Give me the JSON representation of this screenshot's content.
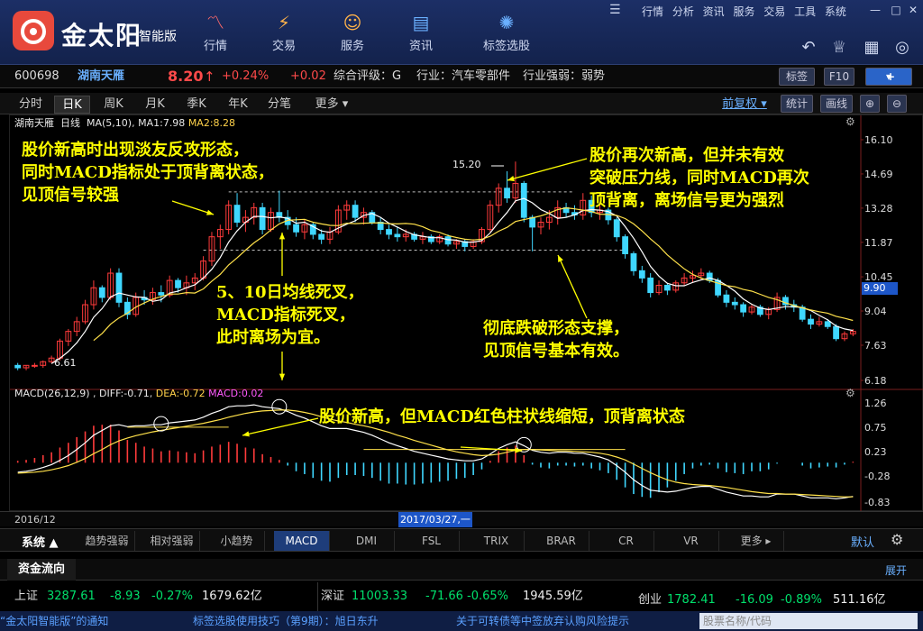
{
  "app": {
    "logo_text": "金太阳",
    "logo_sub": "智能版"
  },
  "nav": [
    {
      "label": "行情",
      "icon": "chart-line-icon"
    },
    {
      "label": "交易",
      "icon": "trade-icon"
    },
    {
      "label": "服务",
      "icon": "user-icon"
    },
    {
      "label": "资讯",
      "icon": "news-icon"
    },
    {
      "label": "标签选股",
      "icon": "bulb-icon"
    }
  ],
  "topmenu": "行情 分析 资讯 服务 交易 工具 系统",
  "stock": {
    "code": "600698",
    "name": "湖南天雁",
    "price": "8.20",
    "arrow": "↑",
    "pct": "+0.24%",
    "chg": "+0.02",
    "rating": "综合评级：G",
    "industry": "行业：汽车零部件",
    "strength": "行业强弱：弱势"
  },
  "buttons": {
    "tag": "标签",
    "f10": "F10",
    "plus": "+"
  },
  "period_tabs": [
    "分时",
    "日K",
    "周K",
    "月K",
    "季K",
    "年K",
    "分笔",
    "更多 ▾"
  ],
  "right_tools": {
    "fq": "前复权 ▾",
    "stat": "统计",
    "draw": "画线"
  },
  "main_legend": {
    "name": "湖南天雁",
    "period": "日线",
    "ma": "MA(5,10)",
    "ma1": "MA1:7.98",
    "ma2": "MA2:8.28"
  },
  "macd_legend": {
    "name": "MACD(26,12,9)",
    "diff": "DIFF:-0.71",
    "dea": "DEA:-0.72",
    "macd": "MACD:0.02"
  },
  "annotations": {
    "a1": "股价新高时出现淡友反攻形态，\n同时MACD指标处于顶背离状态，\n见顶信号较强",
    "a2": "股价再次新高，但并未有效\n突破压力线，同时MACD再次\n顶背离，离场信号更为强烈",
    "a3": "5、10日均线死叉，\nMACD指标死叉，\n此时离场为宜。",
    "a4": "彻底跌破形态支撑，\n见顶信号基本有效。",
    "a5": "股价新高，但MACD红色柱状线缩短，顶背离状态"
  },
  "price_labels": {
    "high": "15.20",
    "low": "6.61",
    "current": "9.90"
  },
  "dates": {
    "start": "2016/12",
    "cursor": "2017/03/27,一"
  },
  "indicator_tabs": [
    "趋势强弱",
    "相对强弱",
    "小趋势",
    "MACD",
    "DMI",
    "FSL",
    "TRIX",
    "BRAR",
    "CR",
    "VR",
    "更多 ▸"
  ],
  "indicator_active": "MACD",
  "system_label": "系统 ▲",
  "default_label": "默认",
  "flow": {
    "label": "资金流向",
    "expand": "展开"
  },
  "market": {
    "sh": {
      "name": "上证",
      "value": "3287.61",
      "chg": "-8.93",
      "pct": "-0.27%",
      "amt": "1679.62亿"
    },
    "sz": {
      "name": "深证",
      "value": "11003.33",
      "chg": "-71.66",
      "pct": "-0.65%",
      "amt": "1945.59亿"
    },
    "cy": {
      "name": "创业",
      "value": "1782.41",
      "chg": "-16.09",
      "pct": "-0.89%",
      "amt": "511.16亿"
    }
  },
  "status": {
    "s1": "“金太阳智能版”的通知",
    "s2": "标签选股使用技巧（第9期）：旭日东升",
    "s3": "关于可转债等中签放弃认购风险提示",
    "search": "股票名称/代码"
  },
  "chart_data": {
    "type": "candlestick",
    "yaxis_main": [
      16.1,
      14.69,
      13.28,
      11.87,
      10.45,
      9.04,
      7.63,
      6.18
    ],
    "yaxis_macd": [
      1.26,
      0.75,
      0.23,
      -0.28,
      -0.83
    ],
    "ylim_main": [
      6.18,
      16.1
    ],
    "ylim_macd": [
      -0.83,
      1.26
    ],
    "candles": [
      [
        6.8,
        6.9,
        6.6,
        6.7
      ],
      [
        6.7,
        6.8,
        6.6,
        6.8
      ],
      [
        6.8,
        6.9,
        6.7,
        6.8
      ],
      [
        6.8,
        7.0,
        6.7,
        6.95
      ],
      [
        6.95,
        7.2,
        6.9,
        7.1
      ],
      [
        7.1,
        7.9,
        7.0,
        7.8
      ],
      [
        7.8,
        8.3,
        7.6,
        8.2
      ],
      [
        8.2,
        8.8,
        8.0,
        8.6
      ],
      [
        8.6,
        9.5,
        8.5,
        9.3
      ],
      [
        9.3,
        10.3,
        9.1,
        10.0
      ],
      [
        10.0,
        10.1,
        9.4,
        9.6
      ],
      [
        9.6,
        10.8,
        9.5,
        10.6
      ],
      [
        10.6,
        10.8,
        9.2,
        9.4
      ],
      [
        9.4,
        9.6,
        8.7,
        8.9
      ],
      [
        8.9,
        9.8,
        8.8,
        9.6
      ],
      [
        9.6,
        9.9,
        9.3,
        9.5
      ],
      [
        9.5,
        10.0,
        9.3,
        9.8
      ],
      [
        9.8,
        10.1,
        9.4,
        9.7
      ],
      [
        9.7,
        10.5,
        9.6,
        10.3
      ],
      [
        10.3,
        10.4,
        9.8,
        10.0
      ],
      [
        10.0,
        10.5,
        9.7,
        10.2
      ],
      [
        10.2,
        10.6,
        9.9,
        10.4
      ],
      [
        10.4,
        11.3,
        10.3,
        11.1
      ],
      [
        11.1,
        12.3,
        10.9,
        12.1
      ],
      [
        12.1,
        12.6,
        11.6,
        12.4
      ],
      [
        12.4,
        13.6,
        12.2,
        13.4
      ],
      [
        13.4,
        13.9,
        12.5,
        12.7
      ],
      [
        12.7,
        13.2,
        12.3,
        12.9
      ],
      [
        12.9,
        13.5,
        12.6,
        13.3
      ],
      [
        13.3,
        13.5,
        12.2,
        12.4
      ],
      [
        12.4,
        13.3,
        12.3,
        13.1
      ],
      [
        13.1,
        14.0,
        12.7,
        12.9
      ],
      [
        12.9,
        13.2,
        12.4,
        12.6
      ],
      [
        12.6,
        12.9,
        12.1,
        12.3
      ],
      [
        12.3,
        12.8,
        12.0,
        12.6
      ],
      [
        12.6,
        12.7,
        12.0,
        12.2
      ],
      [
        12.2,
        12.4,
        11.8,
        12.0
      ],
      [
        12.0,
        12.5,
        11.8,
        12.3
      ],
      [
        12.3,
        13.4,
        12.2,
        13.2
      ],
      [
        13.2,
        13.6,
        12.8,
        13.4
      ],
      [
        13.4,
        13.6,
        12.7,
        12.9
      ],
      [
        12.9,
        13.3,
        12.6,
        13.1
      ],
      [
        13.1,
        13.2,
        12.6,
        12.7
      ],
      [
        12.7,
        12.9,
        12.2,
        12.4
      ],
      [
        12.4,
        12.6,
        12.0,
        12.2
      ],
      [
        12.2,
        12.5,
        11.9,
        12.1
      ],
      [
        12.1,
        12.4,
        11.9,
        12.2
      ],
      [
        12.2,
        12.3,
        11.9,
        12.0
      ],
      [
        12.0,
        12.3,
        11.8,
        12.1
      ],
      [
        12.1,
        12.2,
        11.8,
        11.9
      ],
      [
        11.9,
        12.2,
        11.8,
        12.1
      ],
      [
        12.1,
        12.2,
        11.7,
        11.8
      ],
      [
        11.8,
        12.0,
        11.6,
        11.9
      ],
      [
        11.9,
        12.0,
        11.5,
        11.7
      ],
      [
        11.7,
        12.0,
        11.6,
        11.9
      ],
      [
        11.9,
        12.5,
        11.8,
        12.4
      ],
      [
        12.4,
        13.6,
        12.3,
        13.4
      ],
      [
        13.4,
        14.3,
        13.1,
        14.1
      ],
      [
        14.1,
        14.8,
        13.5,
        13.7
      ],
      [
        13.7,
        15.2,
        13.5,
        14.3
      ],
      [
        14.3,
        14.4,
        12.7,
        12.9
      ],
      [
        12.9,
        13.0,
        11.5,
        12.5
      ],
      [
        12.5,
        12.9,
        12.2,
        12.7
      ],
      [
        12.7,
        13.2,
        12.4,
        12.9
      ],
      [
        12.9,
        13.6,
        12.6,
        13.3
      ],
      [
        13.3,
        13.5,
        12.9,
        13.1
      ],
      [
        13.1,
        13.4,
        12.8,
        13.0
      ],
      [
        13.0,
        13.9,
        12.8,
        13.6
      ],
      [
        13.6,
        13.8,
        12.9,
        13.1
      ],
      [
        13.1,
        13.4,
        12.8,
        13.2
      ],
      [
        13.2,
        13.3,
        12.6,
        12.8
      ],
      [
        12.8,
        12.9,
        11.9,
        12.1
      ],
      [
        12.1,
        12.2,
        11.2,
        11.4
      ],
      [
        11.4,
        11.5,
        10.5,
        10.7
      ],
      [
        10.7,
        10.9,
        10.2,
        10.4
      ],
      [
        10.4,
        10.6,
        9.6,
        9.8
      ],
      [
        9.8,
        10.3,
        9.7,
        10.1
      ],
      [
        10.1,
        10.2,
        9.7,
        9.9
      ],
      [
        9.9,
        10.3,
        9.8,
        10.2
      ],
      [
        10.2,
        10.6,
        10.1,
        10.4
      ],
      [
        10.4,
        10.7,
        10.2,
        10.5
      ],
      [
        10.5,
        10.8,
        10.3,
        10.6
      ],
      [
        10.6,
        10.7,
        10.2,
        10.3
      ],
      [
        10.3,
        10.4,
        9.6,
        9.7
      ],
      [
        9.7,
        9.9,
        9.2,
        9.4
      ],
      [
        9.4,
        9.6,
        9.1,
        9.3
      ],
      [
        9.3,
        9.4,
        8.8,
        9.0
      ],
      [
        9.0,
        9.3,
        8.9,
        9.2
      ],
      [
        9.2,
        9.3,
        8.8,
        8.9
      ],
      [
        8.9,
        9.2,
        8.7,
        9.1
      ],
      [
        9.1,
        9.8,
        9.0,
        9.6
      ],
      [
        9.6,
        9.7,
        9.1,
        9.3
      ],
      [
        9.3,
        9.5,
        9.0,
        9.2
      ],
      [
        9.2,
        9.3,
        8.6,
        8.7
      ],
      [
        8.7,
        8.9,
        8.3,
        8.5
      ],
      [
        8.5,
        8.8,
        8.4,
        8.6
      ],
      [
        8.6,
        8.7,
        8.3,
        8.4
      ],
      [
        8.4,
        8.5,
        7.8,
        7.9
      ],
      [
        7.9,
        8.2,
        7.8,
        8.1
      ],
      [
        8.1,
        8.3,
        8.0,
        8.2
      ]
    ],
    "ma_window": [
      5,
      10
    ],
    "macd_diff": [
      -0.2,
      -0.18,
      -0.15,
      -0.1,
      -0.04,
      0.05,
      0.15,
      0.28,
      0.42,
      0.58,
      0.68,
      0.78,
      0.8,
      0.76,
      0.78,
      0.78,
      0.8,
      0.8,
      0.84,
      0.86,
      0.88,
      0.9,
      0.96,
      1.04,
      1.1,
      1.18,
      1.2,
      1.2,
      1.22,
      1.18,
      1.16,
      1.14,
      1.08,
      1.0,
      0.94,
      0.86,
      0.78,
      0.72,
      0.72,
      0.72,
      0.68,
      0.64,
      0.58,
      0.5,
      0.42,
      0.36,
      0.3,
      0.24,
      0.2,
      0.16,
      0.12,
      0.08,
      0.06,
      0.04,
      0.04,
      0.08,
      0.18,
      0.3,
      0.38,
      0.44,
      0.36,
      0.26,
      0.22,
      0.2,
      0.22,
      0.22,
      0.2,
      0.2,
      0.16,
      0.12,
      0.06,
      -0.06,
      -0.2,
      -0.36,
      -0.48,
      -0.58,
      -0.6,
      -0.62,
      -0.6,
      -0.56,
      -0.52,
      -0.5,
      -0.5,
      -0.56,
      -0.62,
      -0.66,
      -0.7,
      -0.7,
      -0.72,
      -0.72,
      -0.66,
      -0.66,
      -0.66,
      -0.7,
      -0.74,
      -0.74,
      -0.74,
      -0.76,
      -0.74,
      -0.71
    ],
    "macd_dea": [
      -0.22,
      -0.21,
      -0.2,
      -0.18,
      -0.15,
      -0.11,
      -0.06,
      0.01,
      0.09,
      0.19,
      0.28,
      0.38,
      0.46,
      0.52,
      0.57,
      0.61,
      0.65,
      0.68,
      0.71,
      0.74,
      0.77,
      0.8,
      0.83,
      0.87,
      0.91,
      0.96,
      1.0,
      1.04,
      1.07,
      1.09,
      1.1,
      1.11,
      1.11,
      1.09,
      1.06,
      1.02,
      0.97,
      0.92,
      0.88,
      0.85,
      0.81,
      0.78,
      0.74,
      0.69,
      0.64,
      0.58,
      0.53,
      0.47,
      0.42,
      0.37,
      0.32,
      0.27,
      0.23,
      0.2,
      0.17,
      0.15,
      0.16,
      0.18,
      0.22,
      0.26,
      0.28,
      0.28,
      0.27,
      0.26,
      0.25,
      0.25,
      0.24,
      0.23,
      0.22,
      0.2,
      0.17,
      0.12,
      0.06,
      -0.03,
      -0.12,
      -0.21,
      -0.29,
      -0.36,
      -0.41,
      -0.44,
      -0.46,
      -0.47,
      -0.48,
      -0.5,
      -0.52,
      -0.55,
      -0.58,
      -0.61,
      -0.63,
      -0.65,
      -0.65,
      -0.66,
      -0.66,
      -0.67,
      -0.68,
      -0.69,
      -0.7,
      -0.71,
      -0.72,
      -0.72
    ]
  }
}
